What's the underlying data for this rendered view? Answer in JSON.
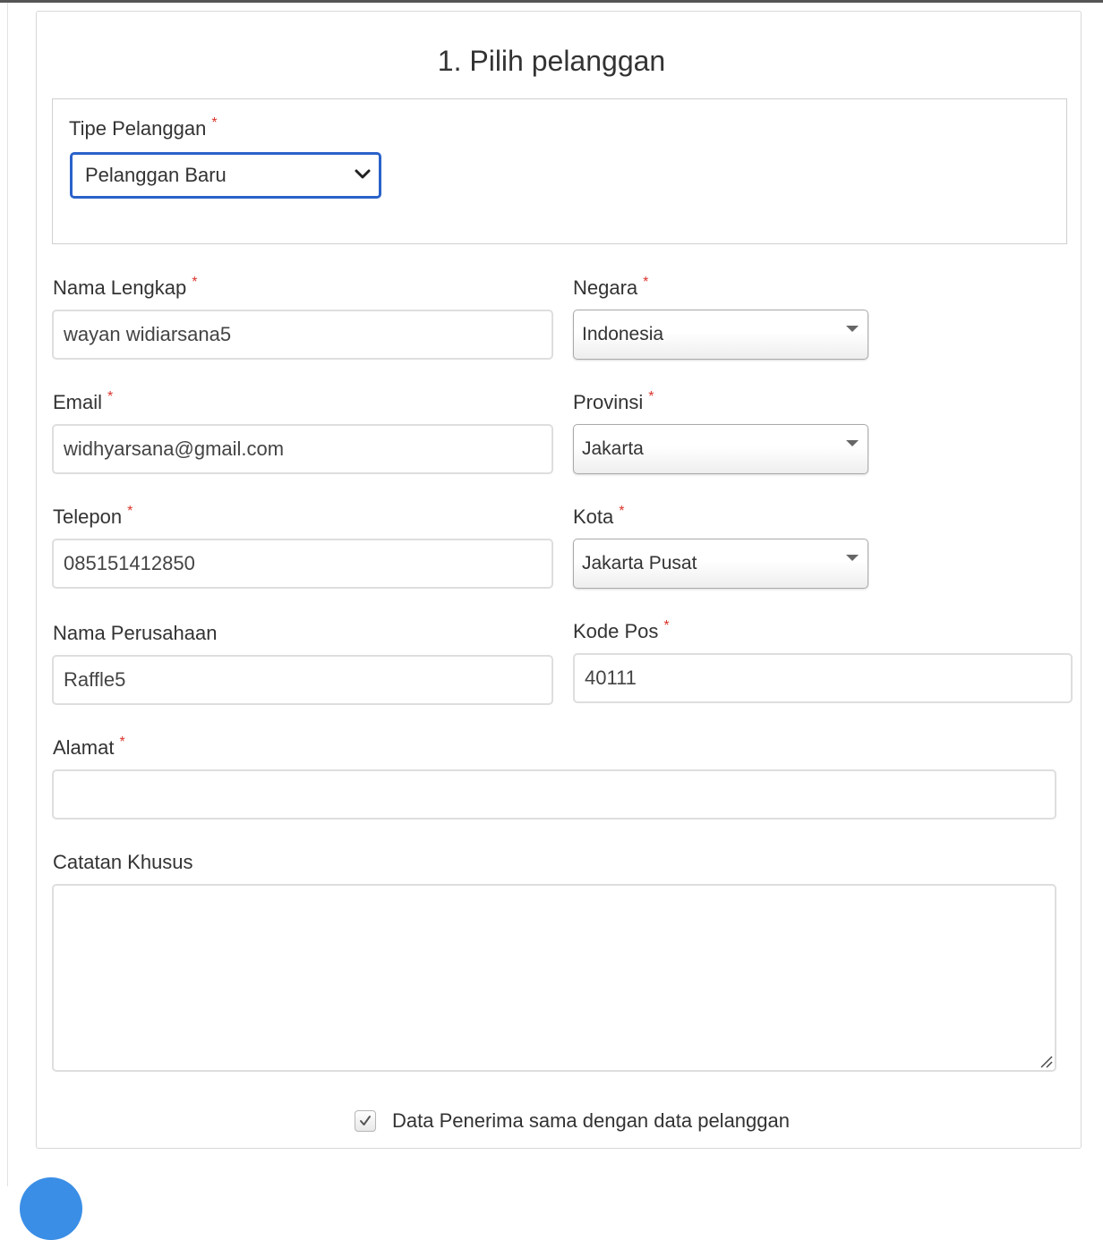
{
  "section": {
    "title": "1. Pilih pelanggan"
  },
  "tipe_pelanggan": {
    "label": "Tipe Pelanggan",
    "required_mark": "*",
    "selected": "Pelanggan Baru"
  },
  "fields": {
    "nama_lengkap": {
      "label": "Nama Lengkap",
      "required_mark": "*",
      "value": "wayan widiarsana5"
    },
    "email": {
      "label": "Email",
      "required_mark": "*",
      "value": "widhyarsana@gmail.com"
    },
    "telepon": {
      "label": "Telepon",
      "required_mark": "*",
      "value": "085151412850"
    },
    "nama_perusahaan": {
      "label": "Nama Perusahaan",
      "value": "Raffle5"
    },
    "negara": {
      "label": "Negara",
      "required_mark": "*",
      "selected": "Indonesia"
    },
    "provinsi": {
      "label": "Provinsi",
      "required_mark": "*",
      "selected": "Jakarta"
    },
    "kota": {
      "label": "Kota",
      "required_mark": "*",
      "selected": "Jakarta Pusat"
    },
    "kode_pos": {
      "label": "Kode Pos",
      "required_mark": "*",
      "value": "40111"
    },
    "alamat": {
      "label": "Alamat",
      "required_mark": "*",
      "value": ""
    },
    "catatan_khusus": {
      "label": "Catatan Khusus",
      "value": ""
    }
  },
  "same_recipient": {
    "label": "Data Penerima sama dengan data pelanggan",
    "checked": true
  },
  "colors": {
    "accent_focus": "#2a62c9",
    "required": "#d9342b",
    "fab": "#3a8ee6"
  }
}
